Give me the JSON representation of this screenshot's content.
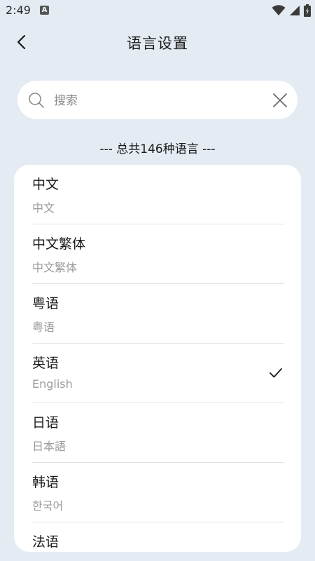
{
  "status_bar": {
    "time": "2:49",
    "notification_letter": "A",
    "icons": [
      "wifi-icon",
      "signal-icon",
      "battery-icon"
    ]
  },
  "header": {
    "title": "语言设置",
    "back_icon": "chevron-left-icon"
  },
  "search": {
    "placeholder": "搜索",
    "value": "",
    "icons": [
      "search-icon",
      "close-icon"
    ]
  },
  "count_label": "--- 总共146种语言 ---",
  "languages": [
    {
      "name": "中文",
      "native": "中文",
      "selected": false
    },
    {
      "name": "中文繁体",
      "native": "中文繁体",
      "selected": false
    },
    {
      "name": "粤语",
      "native": "粤语",
      "selected": false
    },
    {
      "name": "英语",
      "native": "English",
      "selected": true
    },
    {
      "name": "日语",
      "native": "日本語",
      "selected": false
    },
    {
      "name": "韩语",
      "native": "한국어",
      "selected": false
    },
    {
      "name": "法语",
      "native": "",
      "selected": false
    }
  ],
  "colors": {
    "background": "#e4ebf3",
    "card": "#ffffff",
    "secondary_text": "#9a9a9a"
  }
}
